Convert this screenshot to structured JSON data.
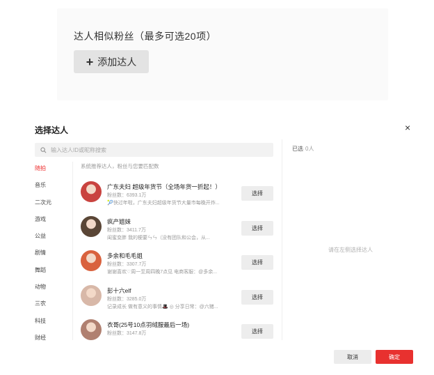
{
  "top": {
    "label": "达人相似粉丝（最多可选20项）",
    "add_button": "添加达人",
    "add_icon": "plus-icon"
  },
  "dialog": {
    "title": "选择达人",
    "close": "×",
    "search_placeholder": "输入达人ID或昵称搜索",
    "selected_label": "已选",
    "selected_count": "0人",
    "empty_hint": "请在左侧选择达人",
    "recommend_hint": "系统推荐达人，粉丝与您要匹配数",
    "categories": [
      "随拍",
      "音乐",
      "二次元",
      "游戏",
      "公益",
      "剧情",
      "舞蹈",
      "动物",
      "三农",
      "科技",
      "财经"
    ],
    "active_category": 0,
    "pick_label": "选择",
    "items": [
      {
        "name": "广东夫妇 超级年货节（全场年货一折起！）",
        "fans": "粉丝数：6393.1万",
        "desc": "🎾快过年啦，广东夫妇超级年货节大量市每晚开炸...",
        "avatar_color": "#c9433f"
      },
      {
        "name": "疯产姐妹",
        "fans": "粉丝数：3411.7万",
        "desc": "闺蜜变胖 我的梗要ㄣㄣ（没有团队和公会，从...",
        "avatar_color": "#5a4636"
      },
      {
        "name": "多余和毛毛姐",
        "fans": "粉丝数：3307.7万",
        "desc": "谢谢喜欢♡周一至周四晚7点见 电商客服：@多余...",
        "avatar_color": "#d9623e"
      },
      {
        "name": "彭十六elf",
        "fans": "粉丝数：3285.0万",
        "desc": "记录成长 做有意义的事情🎩 ◎ 分享日常：@六猪...",
        "avatar_color": "#d8b8a8"
      },
      {
        "name": "衣哥(25号10点羽绒服最后一场)",
        "fans": "粉丝数：3147.8万",
        "desc": "",
        "avatar_color": "#b08070"
      }
    ],
    "cancel": "取消",
    "ok": "确定"
  }
}
